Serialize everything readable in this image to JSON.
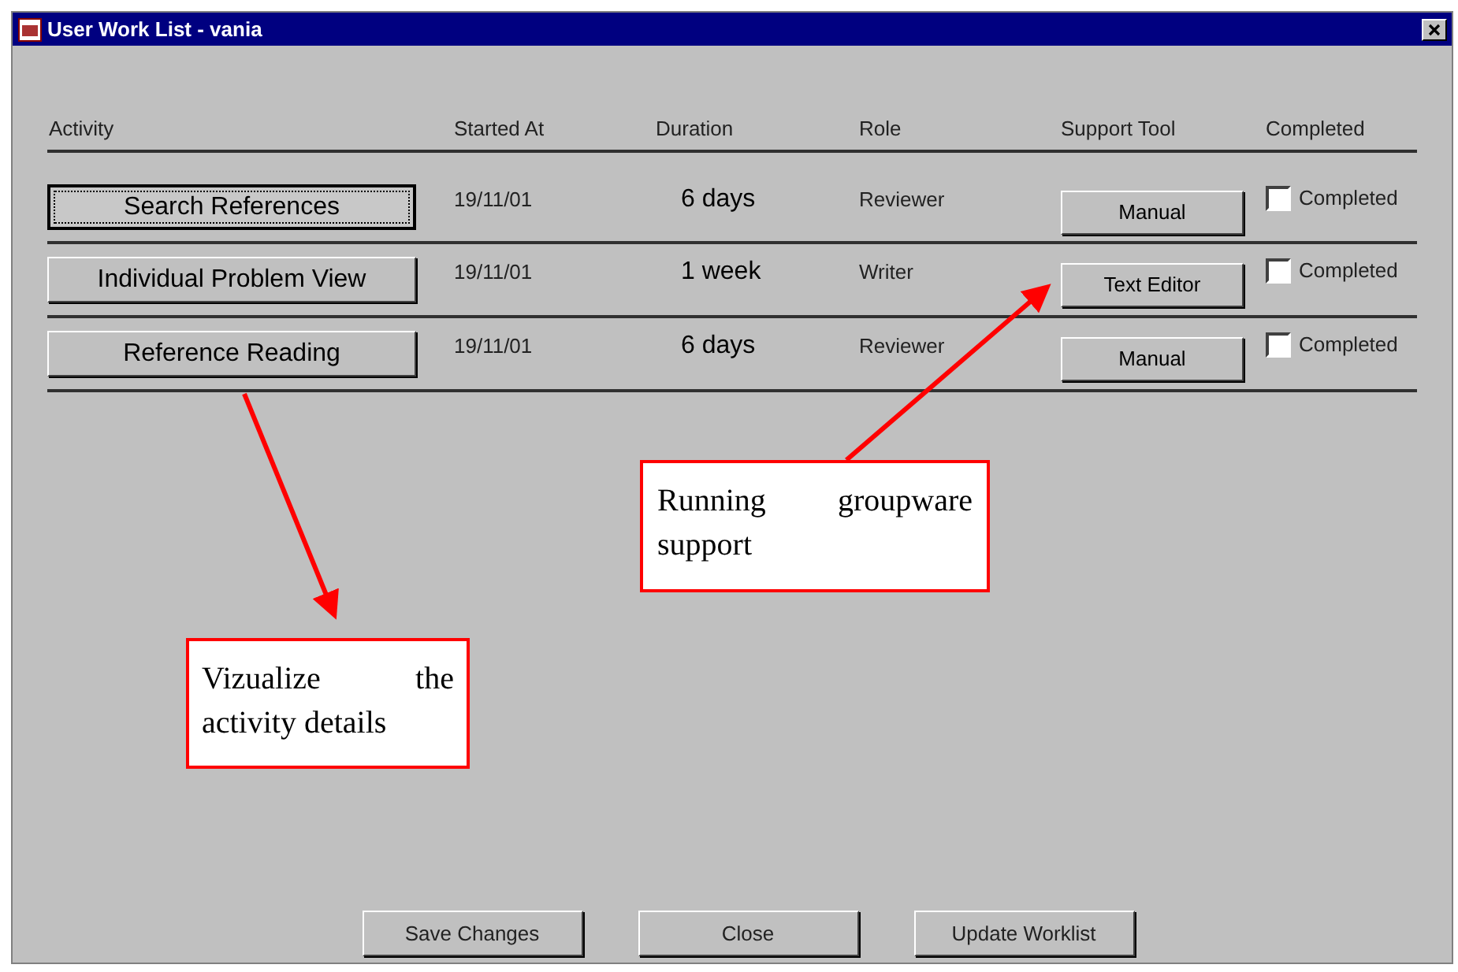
{
  "window": {
    "title": "User Work List - vania"
  },
  "columns": [
    "Activity",
    "Started At",
    "Duration",
    "Role",
    "Support Tool",
    "Completed"
  ],
  "rows": [
    {
      "activity": "Search References",
      "focused": true,
      "started_at": "19/11/01",
      "duration": "6 days",
      "role": "Reviewer",
      "support_tool": "Manual",
      "completed": {
        "label": "Completed",
        "checked": false
      }
    },
    {
      "activity": "Individual Problem View",
      "focused": false,
      "started_at": "19/11/01",
      "duration": "1 week",
      "role": "Writer",
      "support_tool": "Text Editor",
      "completed": {
        "label": "Completed",
        "checked": false
      }
    },
    {
      "activity": "Reference Reading",
      "focused": false,
      "started_at": "19/11/01",
      "duration": "6 days",
      "role": "Reviewer",
      "support_tool": "Manual",
      "completed": {
        "label": "Completed",
        "checked": false
      }
    }
  ],
  "buttons": [
    "Save Changes",
    "Close",
    "Update Worklist"
  ],
  "annotations": [
    {
      "text": "Running groupware support"
    },
    {
      "text": "Vizualize the activity details"
    }
  ]
}
